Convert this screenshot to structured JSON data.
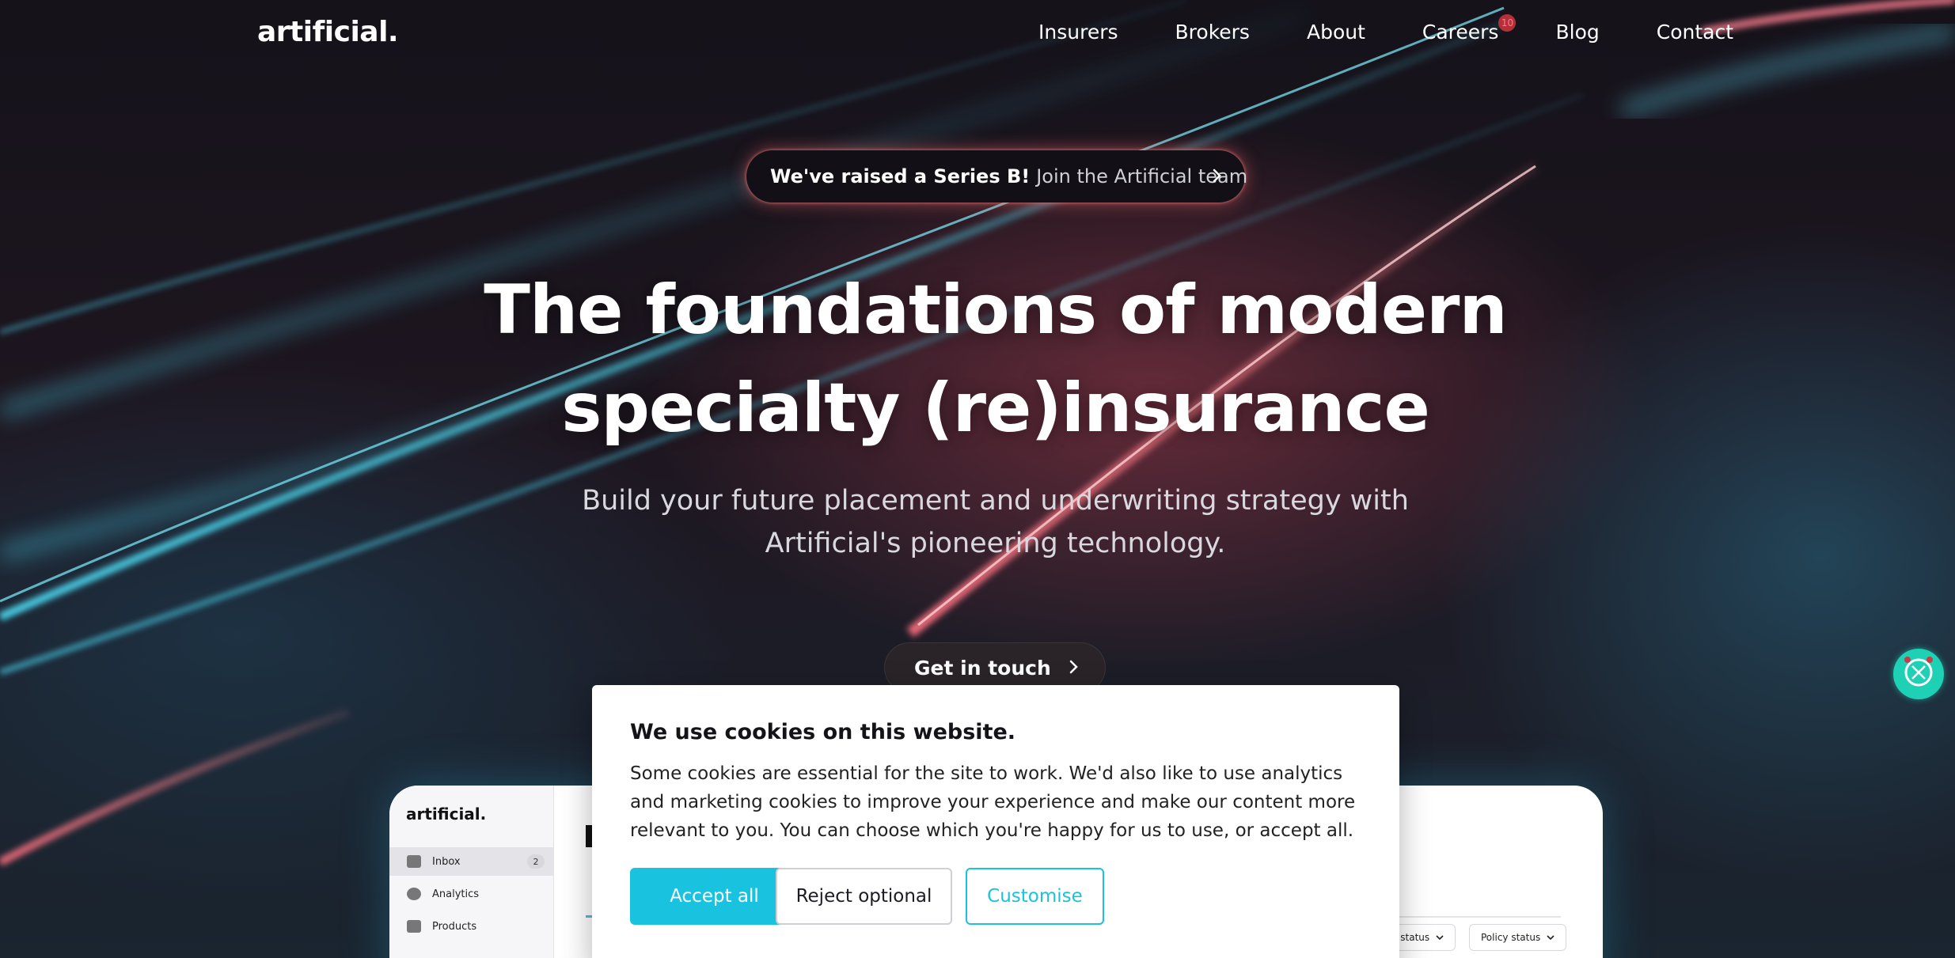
{
  "colors": {
    "accent": "#19c3df",
    "badge": "#b3303a",
    "announce_glow": "#ff6e6e",
    "widget": "#1fd1b4"
  },
  "nav": {
    "logo": "artificial.",
    "links": [
      {
        "label": "Insurers"
      },
      {
        "label": "Brokers"
      },
      {
        "label": "About"
      },
      {
        "label": "Careers",
        "badge": "10"
      },
      {
        "label": "Blog"
      },
      {
        "label": "Contact"
      }
    ]
  },
  "announcement": {
    "strong": "We've raised a Series B!",
    "light": "Join the Artificial team",
    "icon": "chevron-right-icon"
  },
  "hero": {
    "headline_line1": "The foundations of modern",
    "headline_line2": "specialty (re)insurance",
    "subhead_line1": "Build your future placement and underwriting strategy with",
    "subhead_line2": "Artificial's pioneering technology.",
    "cta_label": "Get in touch"
  },
  "preview": {
    "logo": "artificial.",
    "sidebar": [
      {
        "label": "Inbox",
        "count": "2",
        "icon": "inbox-icon"
      },
      {
        "label": "Analytics",
        "icon": "pie-chart-icon"
      },
      {
        "label": "Products",
        "icon": "stack-icon"
      }
    ],
    "filters": [
      "Quote status",
      "Policy status"
    ]
  },
  "cookie": {
    "title": "We use cookies on this website.",
    "body": "Some cookies are essential for the site to work. We'd also like to use analytics and marketing cookies to improve your experience and make our content more relevant to you. You can choose which you're happy for us to use, or accept all.",
    "accept_label": "Accept all",
    "reject_label": "Reject optional",
    "customise_label": "Customise"
  },
  "widget": {
    "icon": "assistant-icon"
  }
}
